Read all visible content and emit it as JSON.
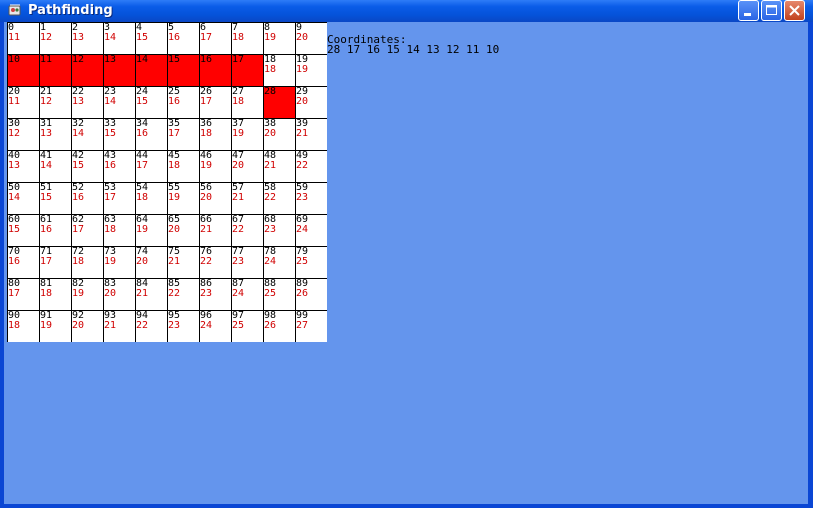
{
  "window": {
    "title": "Pathfinding",
    "icon": "app-icon",
    "buttons": [
      "minimize-icon",
      "maximize-icon",
      "close-icon"
    ],
    "colors": {
      "client_background": "#6495ed",
      "blocked_cell": "#ff0000",
      "distance_text": "#d00000"
    }
  },
  "coordinates": {
    "label": "Coordinates:",
    "path": "28 17 16 15 14 13 12 11 10"
  },
  "grid": {
    "cells": [
      {
        "n": "0",
        "d": "11"
      },
      {
        "n": "1",
        "d": "12"
      },
      {
        "n": "2",
        "d": "13"
      },
      {
        "n": "3",
        "d": "14"
      },
      {
        "n": "4",
        "d": "15"
      },
      {
        "n": "5",
        "d": "16"
      },
      {
        "n": "6",
        "d": "17"
      },
      {
        "n": "7",
        "d": "18"
      },
      {
        "n": "8",
        "d": "19"
      },
      {
        "n": "9",
        "d": "20"
      },
      {
        "n": "10",
        "d": "",
        "blocked": true
      },
      {
        "n": "11",
        "d": "",
        "blocked": true
      },
      {
        "n": "12",
        "d": "",
        "blocked": true
      },
      {
        "n": "13",
        "d": "",
        "blocked": true
      },
      {
        "n": "14",
        "d": "",
        "blocked": true
      },
      {
        "n": "15",
        "d": "",
        "blocked": true
      },
      {
        "n": "16",
        "d": "",
        "blocked": true
      },
      {
        "n": "17",
        "d": "",
        "blocked": true
      },
      {
        "n": "18",
        "d": "18"
      },
      {
        "n": "19",
        "d": "19"
      },
      {
        "n": "20",
        "d": "11"
      },
      {
        "n": "21",
        "d": "12"
      },
      {
        "n": "22",
        "d": "13"
      },
      {
        "n": "23",
        "d": "14"
      },
      {
        "n": "24",
        "d": "15"
      },
      {
        "n": "25",
        "d": "16"
      },
      {
        "n": "26",
        "d": "17"
      },
      {
        "n": "27",
        "d": "18"
      },
      {
        "n": "28",
        "d": "",
        "blocked": true
      },
      {
        "n": "29",
        "d": "20"
      },
      {
        "n": "30",
        "d": "12"
      },
      {
        "n": "31",
        "d": "13"
      },
      {
        "n": "32",
        "d": "14"
      },
      {
        "n": "33",
        "d": "15"
      },
      {
        "n": "34",
        "d": "16"
      },
      {
        "n": "35",
        "d": "17"
      },
      {
        "n": "36",
        "d": "18"
      },
      {
        "n": "37",
        "d": "19"
      },
      {
        "n": "38",
        "d": "20"
      },
      {
        "n": "39",
        "d": "21"
      },
      {
        "n": "40",
        "d": "13"
      },
      {
        "n": "41",
        "d": "14"
      },
      {
        "n": "42",
        "d": "15"
      },
      {
        "n": "43",
        "d": "16"
      },
      {
        "n": "44",
        "d": "17"
      },
      {
        "n": "45",
        "d": "18"
      },
      {
        "n": "46",
        "d": "19"
      },
      {
        "n": "47",
        "d": "20"
      },
      {
        "n": "48",
        "d": "21"
      },
      {
        "n": "49",
        "d": "22"
      },
      {
        "n": "50",
        "d": "14"
      },
      {
        "n": "51",
        "d": "15"
      },
      {
        "n": "52",
        "d": "16"
      },
      {
        "n": "53",
        "d": "17"
      },
      {
        "n": "54",
        "d": "18"
      },
      {
        "n": "55",
        "d": "19"
      },
      {
        "n": "56",
        "d": "20"
      },
      {
        "n": "57",
        "d": "21"
      },
      {
        "n": "58",
        "d": "22"
      },
      {
        "n": "59",
        "d": "23"
      },
      {
        "n": "60",
        "d": "15"
      },
      {
        "n": "61",
        "d": "16"
      },
      {
        "n": "62",
        "d": "17"
      },
      {
        "n": "63",
        "d": "18"
      },
      {
        "n": "64",
        "d": "19"
      },
      {
        "n": "65",
        "d": "20"
      },
      {
        "n": "66",
        "d": "21"
      },
      {
        "n": "67",
        "d": "22"
      },
      {
        "n": "68",
        "d": "23"
      },
      {
        "n": "69",
        "d": "24"
      },
      {
        "n": "70",
        "d": "16"
      },
      {
        "n": "71",
        "d": "17"
      },
      {
        "n": "72",
        "d": "18"
      },
      {
        "n": "73",
        "d": "19"
      },
      {
        "n": "74",
        "d": "20"
      },
      {
        "n": "75",
        "d": "21"
      },
      {
        "n": "76",
        "d": "22"
      },
      {
        "n": "77",
        "d": "23"
      },
      {
        "n": "78",
        "d": "24"
      },
      {
        "n": "79",
        "d": "25"
      },
      {
        "n": "80",
        "d": "17"
      },
      {
        "n": "81",
        "d": "18"
      },
      {
        "n": "82",
        "d": "19"
      },
      {
        "n": "83",
        "d": "20"
      },
      {
        "n": "84",
        "d": "21"
      },
      {
        "n": "85",
        "d": "22"
      },
      {
        "n": "86",
        "d": "23"
      },
      {
        "n": "87",
        "d": "24"
      },
      {
        "n": "88",
        "d": "25"
      },
      {
        "n": "89",
        "d": "26"
      },
      {
        "n": "90",
        "d": "18"
      },
      {
        "n": "91",
        "d": "19"
      },
      {
        "n": "92",
        "d": "20"
      },
      {
        "n": "93",
        "d": "21"
      },
      {
        "n": "94",
        "d": "22"
      },
      {
        "n": "95",
        "d": "23"
      },
      {
        "n": "96",
        "d": "24"
      },
      {
        "n": "97",
        "d": "25"
      },
      {
        "n": "98",
        "d": "26"
      },
      {
        "n": "99",
        "d": "27"
      }
    ]
  }
}
